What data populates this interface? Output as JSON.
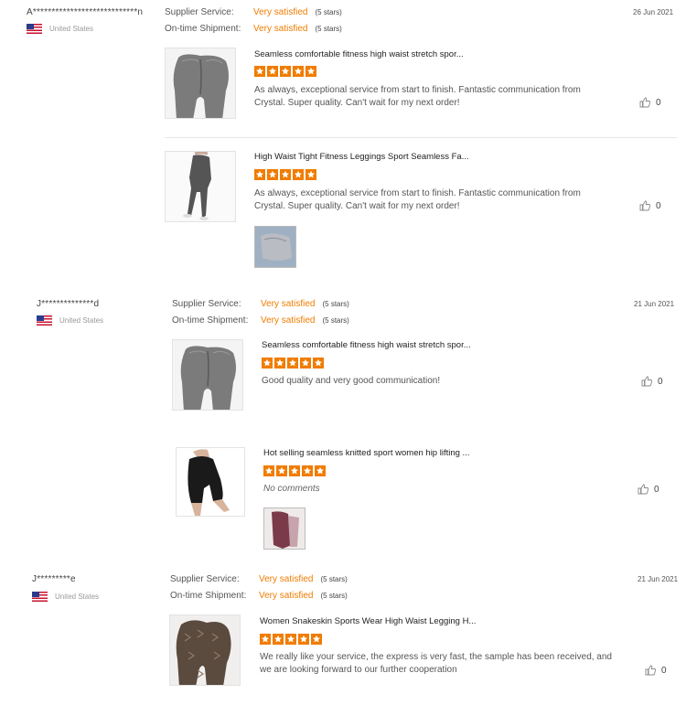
{
  "reviews": [
    {
      "buyer": "A****************************n",
      "country": "United States",
      "supplier_label": "Supplier Service:",
      "supplier_value": "Very satisfied",
      "supplier_stars": "(5 stars)",
      "shipment_label": "On-time Shipment:",
      "shipment_value": "Very satisfied",
      "shipment_stars": "(5 stars)",
      "date": "26 Jun 2021",
      "products": [
        {
          "title": "Seamless comfortable fitness high waist stretch spor...",
          "comment": "As always, exceptional service from start to finish. Fantastic communication from Crystal. Super quality. Can't wait for my next order!",
          "likes": "0"
        },
        {
          "title": "High Waist Tight Fitness Leggings Sport Seamless Fa...",
          "comment": "As always, exceptional service from start to finish. Fantastic communication from Crystal. Super quality. Can't wait for my next order!",
          "likes": "0"
        }
      ]
    },
    {
      "buyer": "J**************d",
      "country": "United States",
      "supplier_label": "Supplier Service:",
      "supplier_value": "Very satisfied",
      "supplier_stars": "(5 stars)",
      "shipment_label": "On-time Shipment:",
      "shipment_value": "Very satisfied",
      "shipment_stars": "(5 stars)",
      "date": "21 Jun 2021",
      "products": [
        {
          "title": "Seamless comfortable fitness high waist stretch spor...",
          "comment": "Good quality and very good communication!",
          "likes": "0"
        },
        {
          "title": "Hot selling seamless knitted sport women hip lifting ...",
          "comment": "No comments",
          "likes": "0"
        }
      ]
    },
    {
      "buyer": "J*********e",
      "country": "United States",
      "supplier_label": "Supplier Service:",
      "supplier_value": "Very satisfied",
      "supplier_stars": "(5 stars)",
      "shipment_label": "On-time Shipment:",
      "shipment_value": "Very satisfied",
      "shipment_stars": "(5 stars)",
      "date": "21 Jun 2021",
      "products": [
        {
          "title": "Women Snakeskin Sports Wear High Waist Legging H...",
          "comment": "We really like your service, the express is very fast, the sample has been received, and we are looking forward to our further cooperation",
          "likes": "0"
        }
      ]
    }
  ],
  "colors": {
    "accent": "#f07c00",
    "star": "#f07c00"
  }
}
